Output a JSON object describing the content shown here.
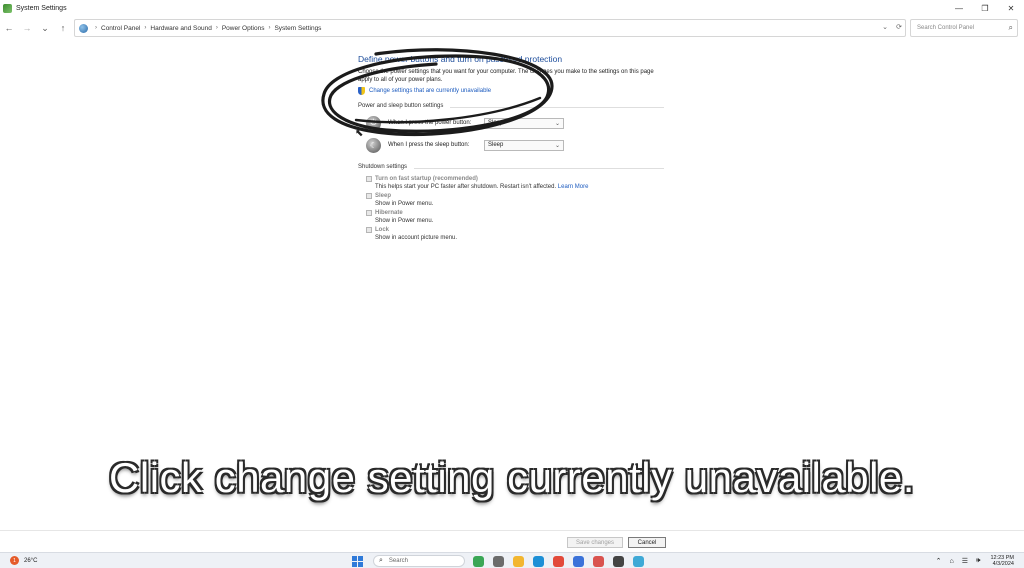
{
  "window": {
    "title": "System Settings",
    "controls": {
      "minimize": "—",
      "restore": "❐",
      "close": "✕"
    }
  },
  "nav": {
    "back": "←",
    "forward": "→",
    "recent": "⌄",
    "up": "↑"
  },
  "breadcrumb": [
    "Control Panel",
    "Hardware and Sound",
    "Power Options",
    "System Settings"
  ],
  "address_controls": {
    "dropdown": "⌄",
    "refresh": "⟳"
  },
  "search": {
    "placeholder": "Search Control Panel"
  },
  "content": {
    "heading": "Define power buttons and turn on password protection",
    "intro": "Choose the power settings that you want for your computer. The changes you make to the settings on this page apply to all of your power plans.",
    "change_link": "Change settings that are currently unavailable",
    "power_section_title": "Power and sleep button settings",
    "power_button_label": "When I press the power button:",
    "power_button_value": "Sleep",
    "sleep_button_label": "When I press the sleep button:",
    "sleep_button_value": "Sleep",
    "shutdown_section_title": "Shutdown settings",
    "options": [
      {
        "label": "Turn on fast startup (recommended)",
        "desc": "This helps start your PC faster after shutdown. Restart isn't affected. ",
        "link": "Learn More"
      },
      {
        "label": "Sleep",
        "desc": "Show in Power menu."
      },
      {
        "label": "Hibernate",
        "desc": "Show in Power menu."
      },
      {
        "label": "Lock",
        "desc": "Show in account picture menu."
      }
    ]
  },
  "caption": "Click change setting currently unavailable.",
  "footer": {
    "save": "Save changes",
    "cancel": "Cancel"
  },
  "taskbar": {
    "weather_badge": "1",
    "weather": "26°C",
    "search": "Search",
    "clock_time": "12:23 PM",
    "clock_date": "4/3/2024",
    "apps": [
      {
        "name": "plant-app-icon",
        "color": "#3aa655"
      },
      {
        "name": "task-view-icon",
        "color": "#6b6b6b"
      },
      {
        "name": "file-explorer-icon",
        "color": "#f2b630"
      },
      {
        "name": "edge-icon",
        "color": "#1d8fd6"
      },
      {
        "name": "chrome-icon",
        "color": "#e24a3b"
      },
      {
        "name": "store-icon",
        "color": "#3a72d9"
      },
      {
        "name": "app-icon",
        "color": "#d9534f"
      },
      {
        "name": "terminal-icon",
        "color": "#444444"
      },
      {
        "name": "remote-desktop-icon",
        "color": "#3fa9d6"
      }
    ],
    "tray_icons": {
      "chevron": "⌃",
      "network": "⌂",
      "wifi": "☰",
      "volume": "🕪"
    }
  }
}
